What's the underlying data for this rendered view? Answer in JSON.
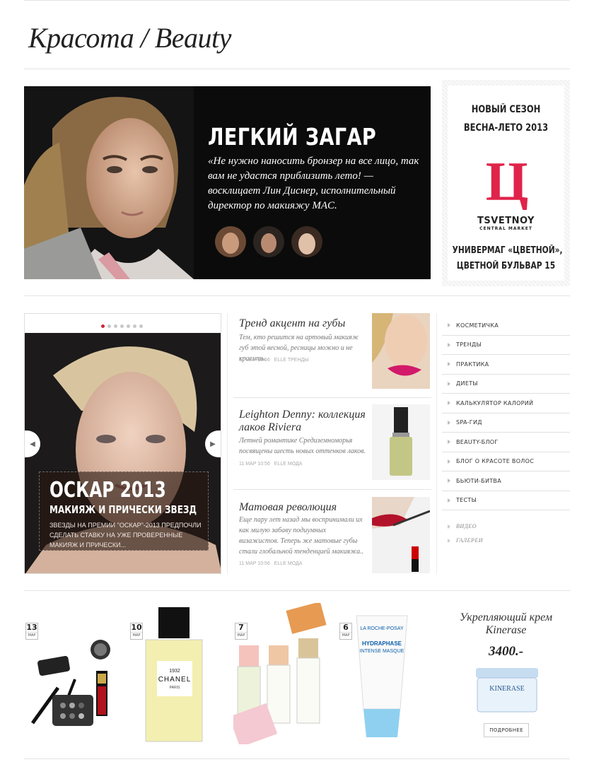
{
  "page": {
    "title": "Красота / Beauty"
  },
  "hero": {
    "title": "ЛЕГКИЙ ЗАГАР",
    "quote": "«Не нужно наносить бронзер на все лицо, так вам не удастся приблизить лето! — восклицает Лин Диснер, исполнительный директор по макияжу MAC."
  },
  "ad": {
    "line1": "НОВЫЙ СЕЗОН",
    "line2": "ВЕСНА-ЛЕТО 2013",
    "logo_letter": "Ц",
    "brand": "TSVETNOY",
    "brand_sub": "CENTRAL MARKET",
    "address1": "УНИВЕРМАГ «ЦВЕТНОЙ»,",
    "address2": "ЦВЕТНОЙ БУЛЬВАР 15"
  },
  "slider": {
    "title": "ОСКАР 2013",
    "subtitle": "МАКИЯЖ И ПРИЧЕСКИ ЗВЕЗД",
    "description": "ЗВЕЗДЫ НА ПРЕМИИ \"ОСКАР\"-2013 ПРЕДПОЧЛИ СДЕЛАТЬ СТАВКУ НА УЖЕ ПРОВЕРЕННЫЕ МАКИЯЖ И ПРИЧЕСКИ...",
    "dots_count": 7,
    "active_dot": 0
  },
  "articles": [
    {
      "title": "Тренд акцент на губы",
      "text": "Тем, кто решится на артовый макияж губ этой весной, ресницы можно и не красить.",
      "date": "11 МАР 10:56",
      "section": "ELLE ТРЕНДЫ"
    },
    {
      "title": "Leighton Denny: коллекция лаков Riviera",
      "text": "Летней романтике Средиземноморья посвящены шесть новых оттенков лаков.",
      "date": "11 МАР 10:56",
      "section": "ELLE МОДА"
    },
    {
      "title": "Матовая революция",
      "text": "Еще пару лет назад мы воспринимали их как милую забаву подиумных визажистов. Теперь же матовые губы стали глобальной тенденцией макияжа..",
      "date": "11 МАР 10:56",
      "section": "ELLE МОДА"
    }
  ],
  "menu": {
    "items": [
      "КОСМЕТИЧКА",
      "ТРЕНДЫ",
      "ПРАКТИКА",
      "ДИЕТЫ",
      "КАЛЬКУЛЯТОР КАЛОРИЙ",
      "SPA-ГИД",
      "BEAUTY-БЛОГ",
      "БЛОГ О КРАСОТЕ ВОЛОС",
      "БЬЮТИ-БИТВА",
      "ТЕСТЫ"
    ],
    "extra": [
      "ВИДЕО",
      "ГАЛЕРЕИ"
    ]
  },
  "products": [
    {
      "day": "13",
      "month": "МАР"
    },
    {
      "day": "10",
      "month": "МАР",
      "label": "CHANEL",
      "label_year": "1932",
      "label_city": "PARIS"
    },
    {
      "day": "7",
      "month": "МАР"
    },
    {
      "day": "6",
      "month": "МАР",
      "brand": "LA ROCHE-POSAY",
      "name1": "HYDRAPHASE",
      "name2": "INTENSE MASQUE"
    }
  ],
  "promo": {
    "title": "Укрепляющий крем Kinerase",
    "price": "3400.-",
    "jar_brand": "KINERASE",
    "button": "ПОДРОБНЕЕ"
  },
  "colors": {
    "accent": "#d0263a",
    "hero_bg": "#0b0b0b",
    "logo_red": "#e0234a"
  }
}
